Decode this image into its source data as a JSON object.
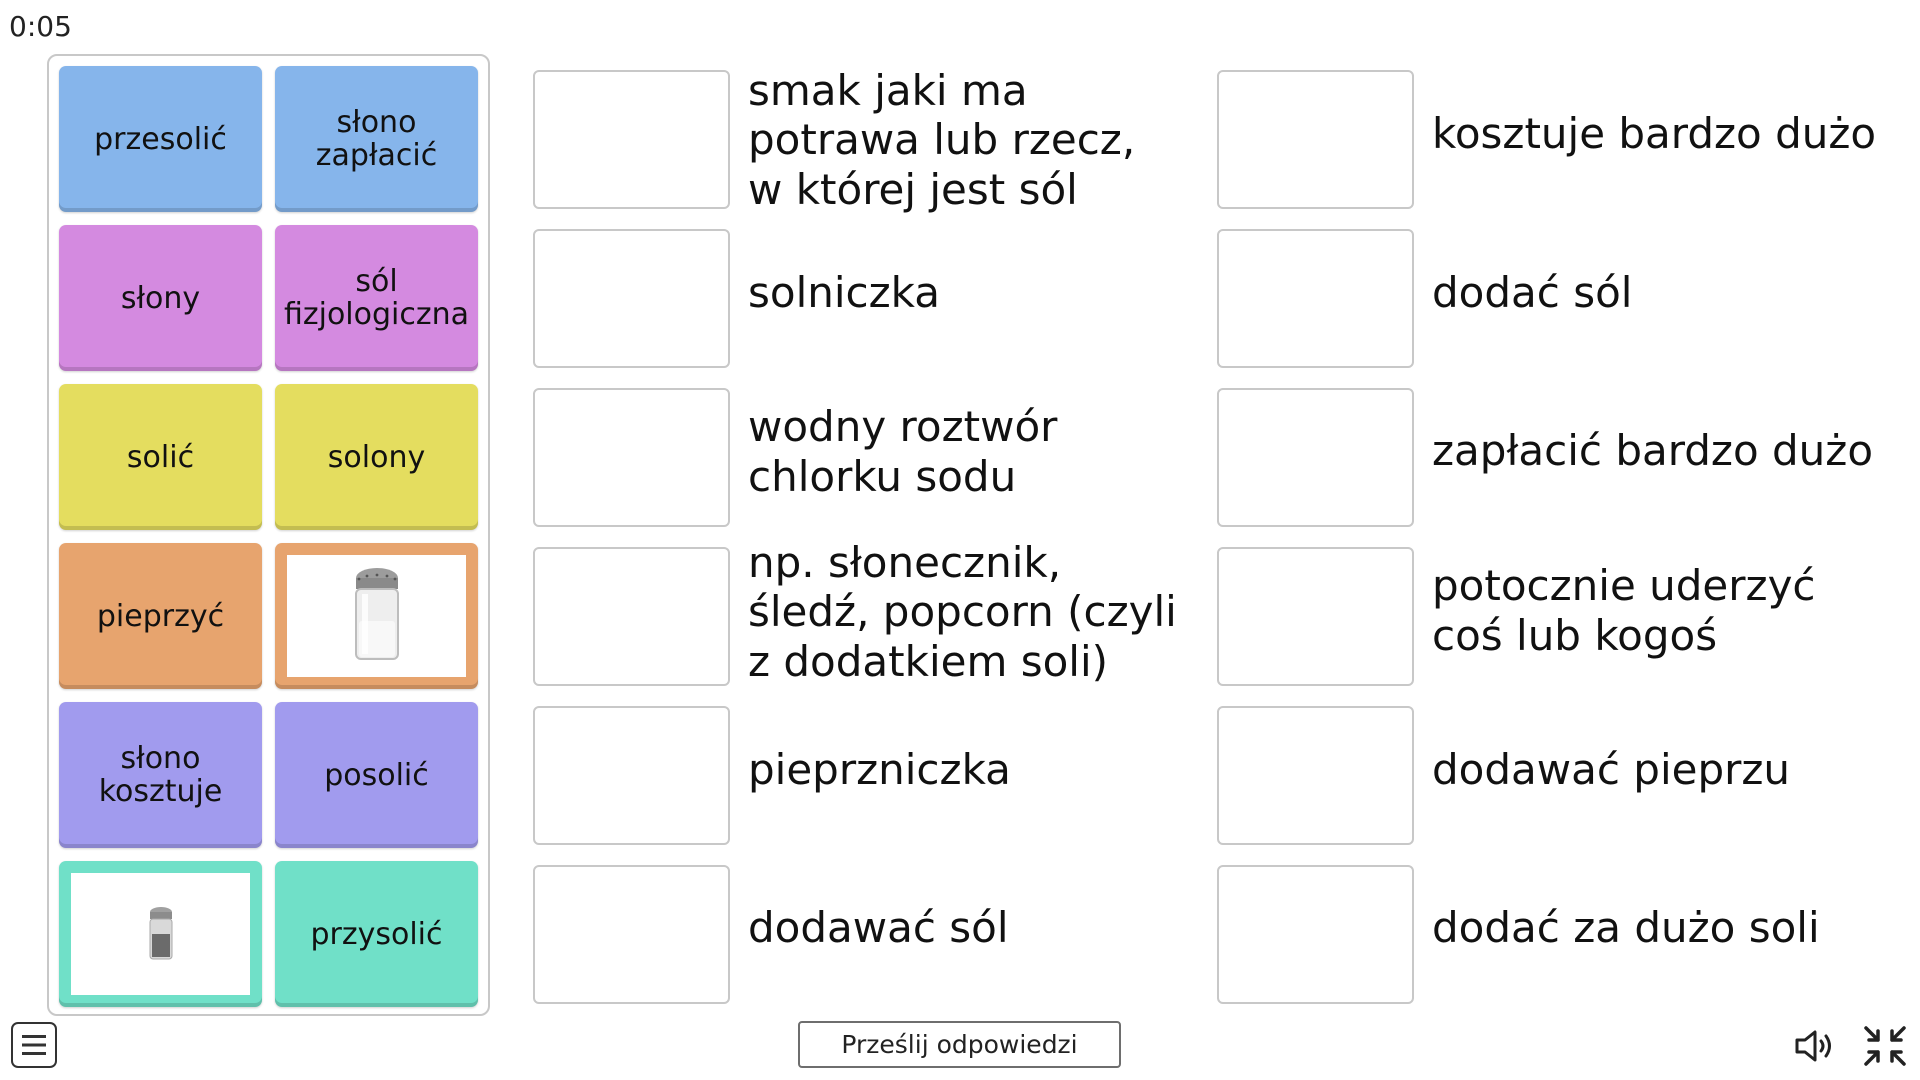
{
  "timer": "0:05",
  "cards": [
    {
      "label": "przesolić",
      "color": "#86b5eb"
    },
    {
      "label": "słono\nzapłacić",
      "color": "#86b5eb"
    },
    {
      "label": "słony",
      "color": "#d48ae0"
    },
    {
      "label": "sól\nfizjologiczna",
      "color": "#d48ae0"
    },
    {
      "label": "solić",
      "color": "#e4dd5f"
    },
    {
      "label": "solony",
      "color": "#e4dd5f"
    },
    {
      "label": "pieprzyć",
      "color": "#e7a46e"
    },
    {
      "image": "salt-shaker-image",
      "color": "#e7a46e"
    },
    {
      "label": "słono\nkosztuje",
      "color": "#a19bee"
    },
    {
      "label": "posolić",
      "color": "#a19bee"
    },
    {
      "image": "pepper-shaker-image",
      "color": "#70e0c8"
    },
    {
      "label": "przysolić",
      "color": "#70e0c8"
    }
  ],
  "definitions_left": [
    [
      "smak jaki ma",
      "potrawa lub rzecz,",
      "w której jest sól"
    ],
    [
      "solniczka"
    ],
    [
      "wodny roztwór",
      "chlorku sodu"
    ],
    [
      "np. słonecznik,",
      "śledź, popcorn (czyli",
      "z dodatkiem soli)"
    ],
    [
      "pieprzniczka"
    ],
    [
      "dodawać sól"
    ]
  ],
  "definitions_right": [
    [
      "kosztuje bardzo dużo"
    ],
    [
      "dodać sól"
    ],
    [
      "zapłacić bardzo dużo"
    ],
    [
      "potocznie uderzyć",
      "coś lub kogoś"
    ],
    [
      "dodawać pieprzu"
    ],
    [
      "dodać za dużo soli"
    ]
  ],
  "submit_label": "Prześlij odpowiedzi",
  "icons": {
    "menu": "menu-icon",
    "sound": "speaker-icon",
    "fullscreen": "exit-fullscreen-icon"
  }
}
